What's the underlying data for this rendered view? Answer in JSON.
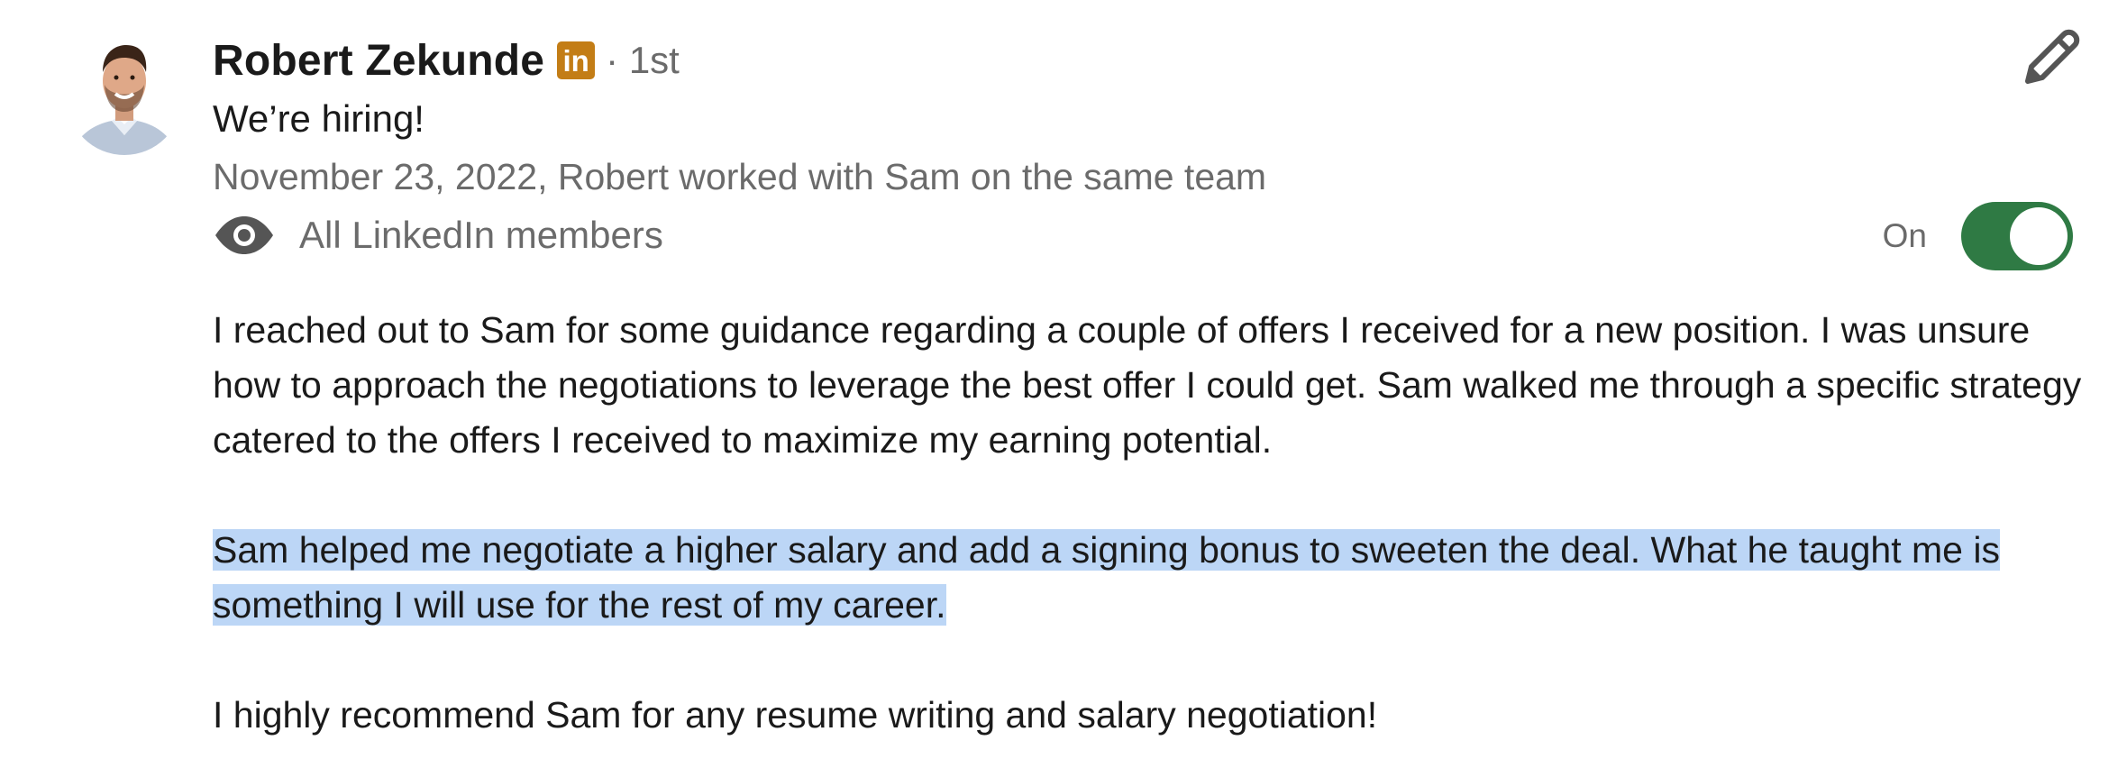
{
  "recommendation": {
    "author": {
      "name": "Robert Zekunde",
      "badge": "in",
      "degree": "· 1st",
      "headline": "We’re hiring!"
    },
    "meta": "November 23, 2022, Robert worked with Sam on the same team",
    "visibility": {
      "label": "All LinkedIn members",
      "icon": "eye-icon"
    },
    "toggle": {
      "state_label": "On",
      "is_on": true
    },
    "paragraphs": {
      "p1": "I reached out to Sam for some guidance regarding a couple of offers I received for a new position. I was unsure how to approach the negotiations to leverage the best offer I could get. Sam walked me through a specific strategy catered to the offers I received to maximize my earning potential.",
      "p2": "Sam helped me negotiate a higher salary and add a signing bonus to sweeten the deal. What he taught me is something I will use for the rest of my career.",
      "p3": "I highly recommend Sam for any resume writing and salary negotiation!"
    }
  },
  "colors": {
    "toggle_on": "#2f7a44",
    "linkedin_badge": "#c37d16",
    "selection": "#bcd6f6",
    "secondary_text": "#6b6b6b"
  }
}
